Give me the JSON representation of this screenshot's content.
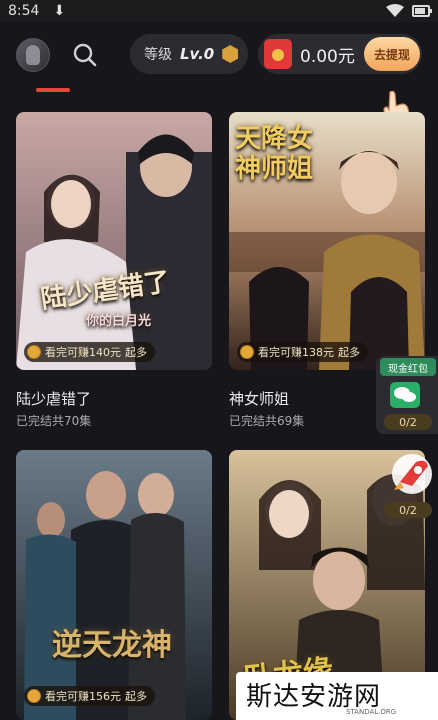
{
  "status_bar": {
    "time": "8:54",
    "download_glyph": "⬇"
  },
  "header": {
    "level_label": "等级",
    "level_value": "Lv.0",
    "cash_value": "0.00元",
    "withdraw_label": "去提现"
  },
  "dramas": [
    {
      "title": "陆少虐错了",
      "subtitle": "已完结共70集",
      "reward": "看完可赚140元",
      "reward_suffix": "起多",
      "poster_art": "陆少虐错了",
      "poster_art_sub": "你的白月光"
    },
    {
      "title": "神女师姐",
      "subtitle": "已完结共69集",
      "reward": "看完可赚138元",
      "reward_suffix": "起多",
      "poster_art": "天降女神师姐"
    },
    {
      "title": "",
      "subtitle": "",
      "reward": "看完可赚156元",
      "reward_suffix": "起多",
      "poster_art": "逆天龙神"
    },
    {
      "title": "",
      "subtitle": "",
      "reward": "",
      "reward_suffix": "",
      "poster_art": "卧龙缘"
    }
  ],
  "float_cash": {
    "header": "现金红包",
    "progress": "0/2",
    "icon": "wechat-icon"
  },
  "float_rocket": {
    "progress": "0/2",
    "icon": "rocket-icon"
  },
  "watermark": {
    "cn": "斯达安游网",
    "en": "STANDAL.ORG"
  },
  "colors": {
    "background": "#16161b",
    "tab_indicator": "#e8453c",
    "pill_bg": "#2b2b31",
    "withdraw_start": "#ffd7a3",
    "withdraw_end": "#f0a65a"
  }
}
